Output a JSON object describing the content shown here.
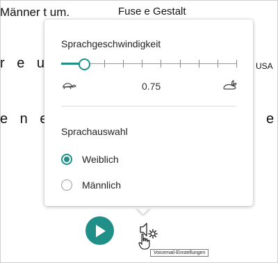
{
  "background": {
    "line1_left": "Männer t um.",
    "line1_center": "Fuse e Gestalt",
    "line2_left": "r e u i",
    "line2_right": "USA",
    "line3_left": "e n e",
    "line3_right": "e"
  },
  "speed": {
    "title": "Sprachgeschwindigkeit",
    "value": "0.75",
    "position": 0.125,
    "tick_count": 8
  },
  "voice": {
    "title": "Sprachauswahl",
    "options": [
      {
        "label": "Weiblich",
        "selected": true
      },
      {
        "label": "Männlich",
        "selected": false
      }
    ]
  },
  "controls": {
    "tooltip": "Voicemail-Einstellungen"
  },
  "icons": {
    "slow": "turtle-icon",
    "fast": "rabbit-icon",
    "play": "play-icon",
    "settings": "speaker-gear-icon",
    "cursor": "hand-pointer-icon"
  },
  "colors": {
    "accent": "#1f8f87"
  }
}
